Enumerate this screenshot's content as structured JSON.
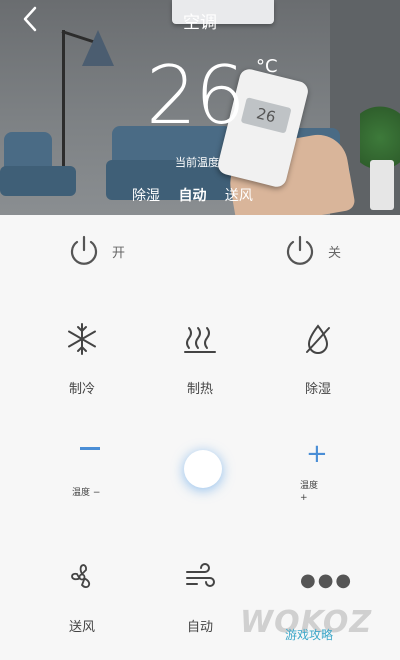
{
  "header": {
    "title": "空调",
    "back_icon": "chevron-left-icon"
  },
  "display": {
    "temperature": "26",
    "unit": "°C",
    "current_label": "当前温度",
    "modes": [
      "除湿",
      "自动",
      "送风"
    ],
    "active_mode": "自动",
    "remote_reading": "26"
  },
  "power": {
    "on_label": "开",
    "off_label": "关"
  },
  "grid": {
    "cool_label": "制冷",
    "heat_label": "制热",
    "dehumid_label": "除湿",
    "fan_label": "送风",
    "auto_label": "自动"
  },
  "temp_control": {
    "minus_label": "温度 −",
    "plus_label_line1": "温度",
    "plus_label_line2": "+"
  },
  "watermark": {
    "text": "WOKOZ",
    "sub": "游戏攻略"
  },
  "colors": {
    "accent": "#4a8ed6",
    "text": "#444444"
  }
}
